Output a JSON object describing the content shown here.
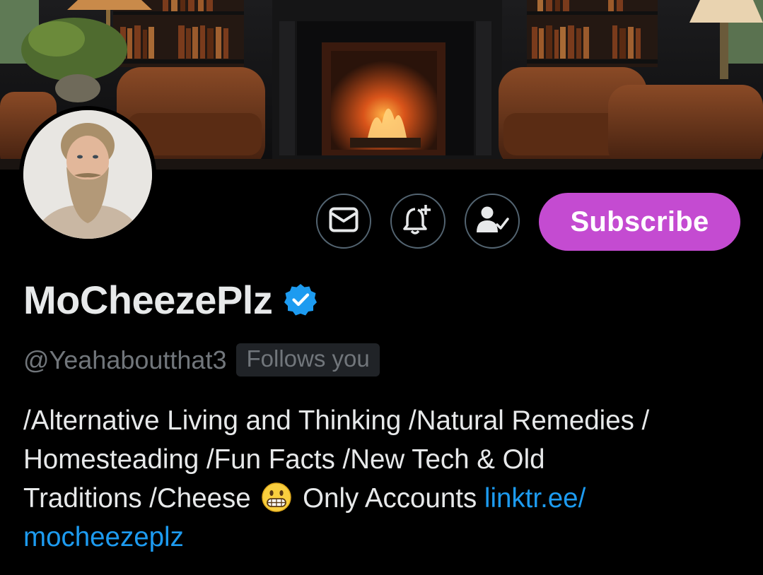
{
  "profile": {
    "display_name": "MoCheezePlz",
    "handle": "@Yeahaboutthat3",
    "follows_you_label": "Follows you",
    "verified": true,
    "bio": {
      "line1": "/Alternative Living and Thinking /Natural Remedies /",
      "line2": "Homesteading  /Fun Facts /New Tech & Old",
      "line3_text": "Traditions /Cheese ",
      "line3_emoji": "grimacing-face",
      "line3_after": " Only Accounts ",
      "link_part1": "linktr.ee/",
      "link_part2": "mocheezeplz"
    }
  },
  "actions": {
    "message_icon": "envelope-icon",
    "notify_icon": "bell-plus-icon",
    "following_icon": "person-check-icon",
    "subscribe_label": "Subscribe"
  },
  "colors": {
    "background": "#000000",
    "subscribe": "#c44bd1",
    "link": "#1d9bf0",
    "verified": "#1d9bf0",
    "secondary_text": "#71767b"
  }
}
